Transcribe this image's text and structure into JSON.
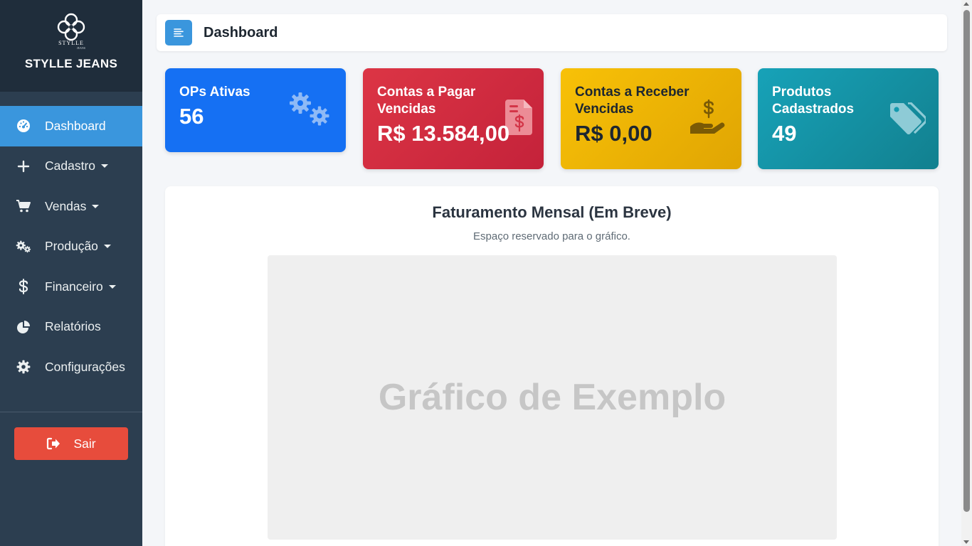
{
  "brand": {
    "logo_text": "STYLLE",
    "logo_sub": "JEANS",
    "name": "STYLLE JEANS"
  },
  "sidebar": {
    "items": [
      {
        "label": "Dashboard",
        "icon": "gauge-icon",
        "active": true,
        "dropdown": false
      },
      {
        "label": "Cadastro",
        "icon": "plus-icon",
        "active": false,
        "dropdown": true
      },
      {
        "label": "Vendas",
        "icon": "cart-icon",
        "active": false,
        "dropdown": true
      },
      {
        "label": "Produção",
        "icon": "gears-icon",
        "active": false,
        "dropdown": true
      },
      {
        "label": "Financeiro",
        "icon": "dollar-icon",
        "active": false,
        "dropdown": true
      },
      {
        "label": "Relatórios",
        "icon": "pie-chart-icon",
        "active": false,
        "dropdown": false
      },
      {
        "label": "Configurações",
        "icon": "gear-icon",
        "active": false,
        "dropdown": false
      }
    ],
    "logout_label": "Sair"
  },
  "header": {
    "title": "Dashboard",
    "menu_icon": "align-left-icon"
  },
  "cards": [
    {
      "title": "OPs Ativas",
      "value": "56",
      "icon": "gears-icon",
      "color": "#1570f3"
    },
    {
      "title": "Contas a Pagar Vencidas",
      "value": "R$ 13.584,00",
      "icon": "invoice-dollar-icon",
      "color": "#dc3545"
    },
    {
      "title": "Contas a Receber Vencidas",
      "value": "R$ 0,00",
      "icon": "hand-dollar-icon",
      "color": "#f8c107"
    },
    {
      "title": "Produtos Cadastrados",
      "value": "49",
      "icon": "tags-icon",
      "color": "#17a2b8"
    }
  ],
  "panel": {
    "title": "Faturamento Mensal (Em Breve)",
    "subtitle": "Espaço reservado para o gráfico.",
    "placeholder": "Gráfico de Exemplo"
  },
  "colors": {
    "sidebar": "#2c3e50",
    "accent": "#3a96dd",
    "danger": "#e74c3c"
  }
}
